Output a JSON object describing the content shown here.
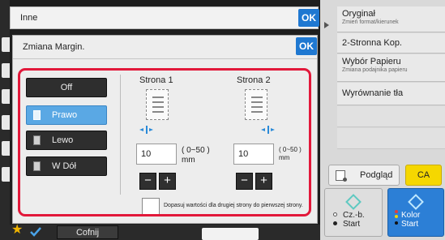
{
  "inne_bar": {
    "title": "Inne",
    "ok_label": "OK"
  },
  "dialog": {
    "title": "Zmiana Margin.",
    "ok_label": "OK",
    "options": [
      {
        "label": "Off",
        "selected": false,
        "icon": null
      },
      {
        "label": "Prawo",
        "selected": true,
        "icon": "page-icon"
      },
      {
        "label": "Lewo",
        "selected": false,
        "icon": "page-icon"
      },
      {
        "label": "W Dół",
        "selected": false,
        "icon": "page-icon"
      }
    ],
    "side1": {
      "label": "Strona 1",
      "value": "10",
      "range": "( 0~50 )",
      "unit": "mm"
    },
    "side2": {
      "label": "Strona 2",
      "value": "10",
      "range": "( 0~50 )",
      "unit": "mm"
    },
    "minus_label": "−",
    "plus_label": "+",
    "match_label": "Dopasuj wartości dla drugiej strony do pierwszej strony.",
    "match_checked": false
  },
  "right_panel": {
    "items": [
      {
        "label": "Oryginał",
        "sub": "Zmień format/kierunek"
      },
      {
        "label": "2-Stronna Kop.",
        "sub": ""
      },
      {
        "label": "Wybór Papieru",
        "sub": "Zmiana podajnika papieru"
      },
      {
        "label": "Wyrównanie tła",
        "sub": ""
      }
    ],
    "preview_label": "Podgląd",
    "ca_label": "CA",
    "start_bw": {
      "line1": "Cz.-b.",
      "line2": "Start"
    },
    "start_color": {
      "line1": "Kolor",
      "line2": "Start"
    }
  },
  "bottom": {
    "back_label": "Cofnij"
  },
  "colors": {
    "accent_blue": "#1f78d1",
    "highlight_red": "#e2183a",
    "selected_option": "#5aa8e4",
    "ca_yellow": "#f5d700",
    "start_blue": "#2c7fd6"
  }
}
